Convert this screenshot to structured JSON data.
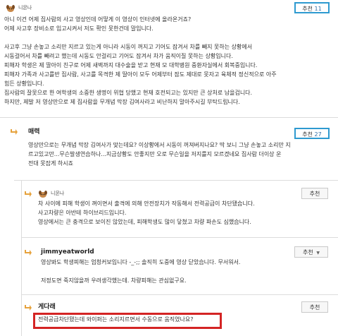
{
  "post": {
    "author": "니몬나",
    "recommend_label": "추천",
    "recommend_count": "11",
    "lines": [
      "아니 이건 어제 집사람의 사고 영상인데 어떻게 이 영상이 인터넷에 올라온거죠?",
      "어제 사고후 장비소로 입고시켜서 저도 확인 못한건데 말입니다.",
      "",
      "사고후 그냥 손놓고 소리만 지르고 있는게 아니라 시동이 꺼지고 기어도 잠겨서 차를 빼지 못하는 상황에서",
      "시동걸어서 차를 빼려고 했는데 시동도 안걸리고 기어도 잠겨서 차가 움직이질 못하는 상황입니다.",
      "피해자 학생은 제 딸아이 친구로 어제 새벽까지 대수술을 받고 현재 모 대학병원 중환자실에서 회복중입니다.",
      "피해자 가족과 사고를반 집사람, 사고를 목격한 제 딸아이 모두 어제부터 잠도 제대로 못자고 육체적 정신적으로 아주",
      "힘든 상황입니다.",
      "집사람의 잘못으로 한 여학생의 소중한 생명이 위협 당했고 현재 호전되고는 있지만 큰 상처로 남을겁니다.",
      "하지만, 제발 저 영상만으로 제 집사람을 무개념 막장 김여사라고 비난하지 말아주시길 부탁드립니다."
    ]
  },
  "reply1": {
    "author": "매력",
    "recommend_label": "추천",
    "recommend_count": "27",
    "lines": [
      "영상만으로는 무개념 막장 김여사가 맞는데요? 이상황에서 시동이 꺼져버지나요? 딱 보니 그냥 손놓고 소리만 지",
      "르고있고만...무슨발생연습하나...지금상황도 안좋지만 오로 무슨일을 저지를지 모르겠네요 집사람 더이상 운",
      "전대 못잡게 하시죠"
    ]
  },
  "reply2": {
    "author": "니몬나",
    "recommend_label": "추천",
    "lines": [
      "차 사이에 피해 학생이 껴이면서 출격에 의해 안전장치가 작동해서 전력공급이 차단됐습니다.",
      "사고차량은 아반테 하이브리드입니다.",
      "영상에서는 큰 충격으로 보이진 않았는데, 피해학생도 많이 닿쳤고 차량 파손도 심했습니다."
    ]
  },
  "reply3": {
    "author": "jimmyeatworld",
    "recommend_label": "추천",
    "chevron": "▼",
    "lines": [
      "영상봐도 학생피해는 엄청커보입니다 -_-;; 솔직히 도중에 영상 닫았습니다. 무서워서.",
      "",
      "저정도면 죽지않을까 우려생각했는데. 차량피해는 관심없구요."
    ]
  },
  "reply4": {
    "author": "게다래",
    "recommend_label": "추천",
    "lines": [
      "전력공급차단됐는데 와이퍼는 소리지르면서 수동으로 움직였나요?"
    ]
  },
  "colors": {
    "highlight_box": "#2e9ad0",
    "red_box": "#d42424",
    "arrow": "#e6a23c"
  },
  "icons": {
    "avatar": "dog-avatar-icon",
    "reply_arrow": "reply-arrow-icon"
  }
}
